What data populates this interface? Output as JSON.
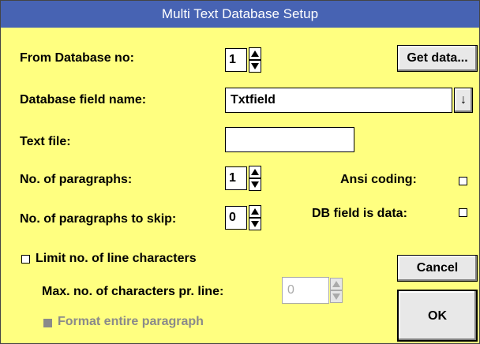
{
  "dialog": {
    "title": "Multi Text Database Setup"
  },
  "from_database": {
    "label": "From Database no:",
    "value": "1"
  },
  "get_data_button": "Get data...",
  "field_name": {
    "label": "Database field name:",
    "value": "Txtfield"
  },
  "dropdown_icon": "↓",
  "text_file": {
    "label": "Text file:",
    "value": ""
  },
  "paragraphs": {
    "label": "No. of paragraphs:",
    "value": "1"
  },
  "ansi_coding": {
    "label": "Ansi coding:",
    "checked": false
  },
  "skip_paragraphs": {
    "label": "No. of paragraphs to skip:",
    "value": "0"
  },
  "db_field_is_data": {
    "label": "DB field is data:",
    "checked": false
  },
  "limit_line_chars": {
    "label": "Limit no. of line characters",
    "checked": false
  },
  "max_chars": {
    "label": "Max. no. of characters pr. line:",
    "value": "0"
  },
  "format_entire": {
    "label": "Format entire paragraph"
  },
  "cancel_button": "Cancel",
  "ok_button": "OK",
  "colors": {
    "background": "#ffff80",
    "titlebar": "#4763b3"
  }
}
